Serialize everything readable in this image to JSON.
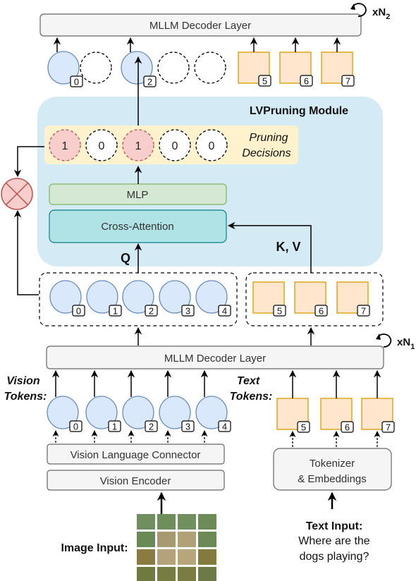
{
  "colors": {
    "vision_fill": "#dae8fc",
    "vision_stroke": "#6c8ebf",
    "text_fill": "#ffe6cc",
    "text_stroke": "#d79b00",
    "module_bg": "#d4ebf5",
    "decision_bg": "#fff2cc",
    "keep_fill": "#f8cecc",
    "keep_stroke": "#b85450",
    "mlp_fill": "#d5e8d4",
    "mlp_stroke": "#82b366",
    "attn_fill": "#b0e3e6",
    "attn_stroke": "#0e8088",
    "layer_fill": "#f5f5f5",
    "layer_stroke": "#666666"
  },
  "top_decoder": {
    "label": "MLLM Decoder Layer",
    "repeat_prefix": "xN",
    "repeat_sub": "2"
  },
  "pruned_tokens": {
    "vision": [
      {
        "index": "0",
        "kept": true
      },
      {
        "index": "1",
        "kept": false
      },
      {
        "index": "2",
        "kept": true
      },
      {
        "index": "3",
        "kept": false
      },
      {
        "index": "4",
        "kept": false
      }
    ],
    "text": [
      "5",
      "6",
      "7"
    ]
  },
  "module": {
    "title": "LVPruning Module",
    "decisions_label_line1": "Pruning",
    "decisions_label_line2": "Decisions",
    "decisions": [
      "1",
      "0",
      "1",
      "0",
      "0"
    ],
    "mlp_label": "MLP",
    "cross_attention_label": "Cross-Attention",
    "q_label": "Q",
    "kv_label": "K, V"
  },
  "intermediate_tokens": {
    "vision": [
      "0",
      "1",
      "2",
      "3",
      "4"
    ],
    "text": [
      "5",
      "6",
      "7"
    ]
  },
  "bottom_decoder": {
    "label": "MLLM Decoder Layer",
    "repeat_prefix": "xN",
    "repeat_sub": "1"
  },
  "input_tokens": {
    "vision_label_line1": "Vision",
    "vision_label_line2": "Tokens:",
    "text_label_line1": "Text",
    "text_label_line2": "Tokens:",
    "vision": [
      "0",
      "1",
      "2",
      "3",
      "4"
    ],
    "text": [
      "5",
      "6",
      "7"
    ]
  },
  "encoders": {
    "connector_label": "Vision Language Connector",
    "vision_encoder_label": "Vision Encoder",
    "tokenizer_line1": "Tokenizer",
    "tokenizer_line2": "& Embeddings"
  },
  "inputs": {
    "image_label": "Image Input:",
    "text_label": "Text Input:",
    "text_line1": "Where are the",
    "text_line2": "dogs playing?"
  },
  "operator_icon": "multiply-circle-icon"
}
